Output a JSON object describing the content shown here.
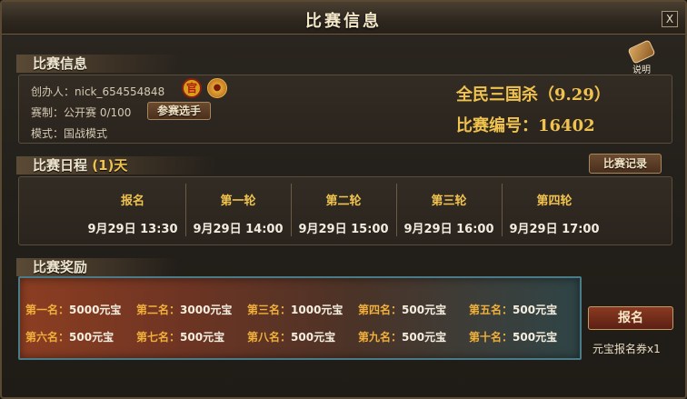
{
  "window": {
    "title": "比赛信息",
    "close": "X"
  },
  "help": {
    "label": "说明"
  },
  "info": {
    "section_title": "比赛信息",
    "creator": "创办人：nick_654554848",
    "format": "赛制：公开赛  0/100",
    "mode": "模式：国战模式",
    "join_button": "参赛选手",
    "official_badge": "官",
    "match_name": "全民三国杀（9.29）",
    "match_id": "比赛编号：16402"
  },
  "schedule": {
    "section_title": "比赛日程",
    "days": "(1)天",
    "record_button": "比赛记录",
    "items": [
      {
        "label": "报名",
        "time": "9月29日 13:30"
      },
      {
        "label": "第一轮",
        "time": "9月29日 14:00"
      },
      {
        "label": "第二轮",
        "time": "9月29日 15:00"
      },
      {
        "label": "第三轮",
        "time": "9月29日 16:00"
      },
      {
        "label": "第四轮",
        "time": "9月29日 17:00"
      }
    ]
  },
  "rewards": {
    "section_title": "比赛奖励",
    "items": [
      {
        "rank": "第一名：",
        "amount": "5000元宝"
      },
      {
        "rank": "第二名：",
        "amount": "3000元宝"
      },
      {
        "rank": "第三名：",
        "amount": "1000元宝"
      },
      {
        "rank": "第四名：",
        "amount": "500元宝"
      },
      {
        "rank": "第五名：",
        "amount": "500元宝"
      },
      {
        "rank": "第六名：",
        "amount": "500元宝"
      },
      {
        "rank": "第七名：",
        "amount": "500元宝"
      },
      {
        "rank": "第八名：",
        "amount": "500元宝"
      },
      {
        "rank": "第九名：",
        "amount": "500元宝"
      },
      {
        "rank": "第十名：",
        "amount": "500元宝"
      }
    ]
  },
  "signup": {
    "button": "报名",
    "ticket": "元宝报名券x1"
  },
  "colors": {
    "gold": "#f0c24e",
    "panel": "#2a241e",
    "reward_rank": "#f2b03a"
  }
}
